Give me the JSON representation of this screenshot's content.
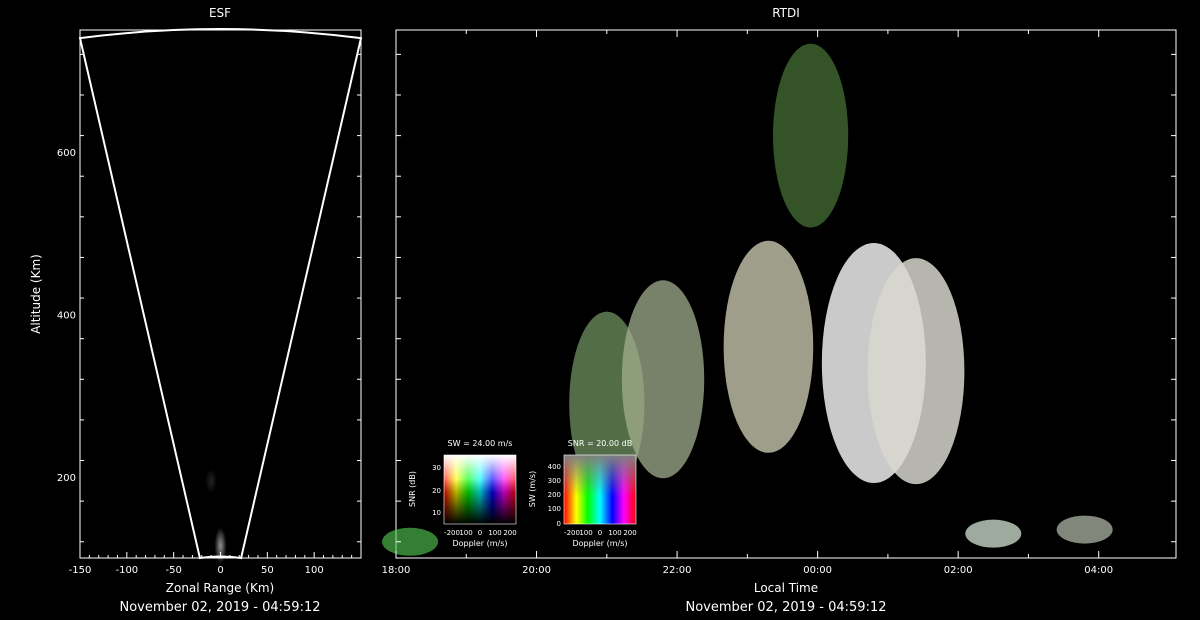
{
  "esf": {
    "title": "ESF",
    "xlabel": "Zonal Range (Km)",
    "ylabel": "Altitude (Km)",
    "footer": "November 02, 2019 - 04:59:12"
  },
  "rtdi": {
    "title": "RTDI",
    "xlabel": "Local Time",
    "footer": "November 02, 2019 - 04:59:12"
  },
  "legend_sw": {
    "title": "SW = 24.00 m/s",
    "ylabel": "SNR (dB)",
    "xlabel": "Doppler (m/s)",
    "yticks": [
      "30",
      "20",
      "10"
    ],
    "xticks": [
      "-200",
      "100",
      "0",
      "100",
      "200"
    ]
  },
  "legend_snr": {
    "title": "SNR = 20.00 dB",
    "ylabel": "SW (m/s)",
    "xlabel": "Doppler (m/s)",
    "yticks": [
      "400",
      "300",
      "200",
      "100",
      "0"
    ],
    "xticks": [
      "-200",
      "100",
      "0",
      "100",
      "200"
    ]
  },
  "chart_data": [
    {
      "type": "heatmap",
      "title": "ESF",
      "xlabel": "Zonal Range (Km)",
      "ylabel": "Altitude (Km)",
      "xlim": [
        -150,
        150
      ],
      "ylim": [
        100,
        750
      ],
      "xticks": [
        -150,
        -100,
        -50,
        0,
        50,
        100
      ],
      "yticks": [
        200,
        400,
        600
      ],
      "beam_sector": {
        "apex_range_km": 0,
        "left_edge_top_km": -150,
        "right_edge_top_km": 150
      },
      "echoes": [
        {
          "x": -10,
          "y": 195,
          "intensity": 0.15
        },
        {
          "x": 0,
          "y": 115,
          "intensity": 0.6
        }
      ]
    },
    {
      "type": "heatmap",
      "title": "RTDI",
      "xlabel": "Local Time",
      "ylabel": "Altitude (Km)",
      "x_tick_labels": [
        "18:00",
        "20:00",
        "22:00",
        "00:00",
        "02:00",
        "04:00"
      ],
      "xlim_hours": [
        18,
        29.1
      ],
      "ylim": [
        100,
        750
      ],
      "features": [
        {
          "time": 18.2,
          "alt": 120,
          "intensity": 0.5,
          "color": "#55cc55"
        },
        {
          "time": 21.0,
          "alt": 290,
          "intensity": 0.6,
          "color": "#7aa06a"
        },
        {
          "time": 21.8,
          "alt": 320,
          "intensity": 0.7,
          "color": "#a3b090"
        },
        {
          "time": 23.3,
          "alt": 360,
          "intensity": 0.8,
          "color": "#c8c8b0"
        },
        {
          "time": 23.9,
          "alt": 620,
          "intensity": 0.6,
          "color": "#4d7a3a"
        },
        {
          "time": 0.8,
          "alt": 340,
          "intensity": 1.0,
          "color": "#e0e0e0"
        },
        {
          "time": 1.4,
          "alt": 330,
          "intensity": 0.9,
          "color": "#d8d8d0"
        },
        {
          "time": 2.5,
          "alt": 130,
          "intensity": 0.8,
          "color": "#c8d8c8"
        },
        {
          "time": 3.8,
          "alt": 135,
          "intensity": 0.7,
          "color": "#b0b8a8"
        }
      ]
    }
  ]
}
